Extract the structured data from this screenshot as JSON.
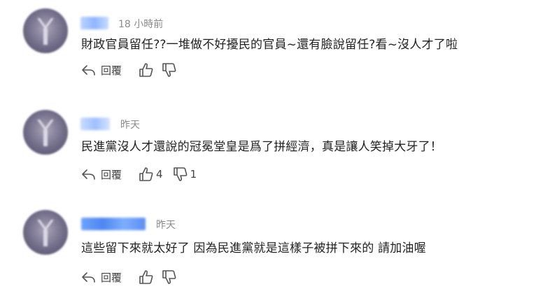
{
  "comments": [
    {
      "time": "18 小時前",
      "text": "財政官員留任??一堆做不好擾民的官員~還有臉說留任?看~沒人才了啦",
      "reply_label": "回覆",
      "like_count": "",
      "dislike_count": ""
    },
    {
      "time": "昨天",
      "text": "民進黨沒人才還說的冠冕堂皇是爲了拼經濟，真是讓人笑掉大牙了！",
      "reply_label": "回覆",
      "like_count": "4",
      "dislike_count": "1"
    },
    {
      "time": "昨天",
      "text": "這些留下來就太好了 因為民進黨就是這樣子被拼下來的 請加油喔",
      "reply_label": "回覆",
      "like_count": "",
      "dislike_count": ""
    }
  ],
  "icons": {
    "reply": "reply-arrow-icon",
    "like": "thumbs-up-icon",
    "dislike": "thumbs-down-icon"
  },
  "colors": {
    "username_blur": "#7fb0ff",
    "meta_text": "#8a8a8a",
    "body_text": "#222222"
  }
}
